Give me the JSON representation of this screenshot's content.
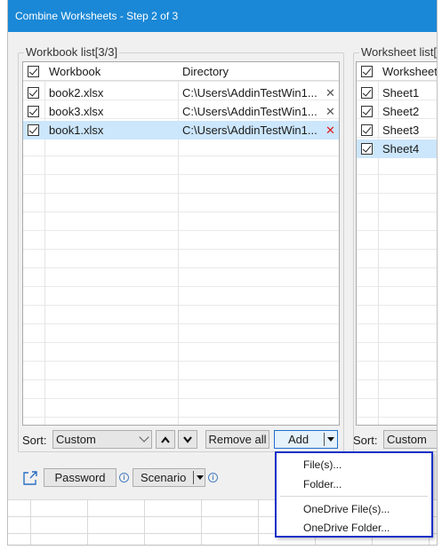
{
  "window": {
    "title": "Combine Worksheets - Step 2 of 3"
  },
  "workbook_panel": {
    "title": "Workbook list[3/3]",
    "columns": [
      "Workbook",
      "Directory"
    ],
    "rows": [
      {
        "name": "book2.xlsx",
        "directory": "C:\\Users\\AddinTestWin1...",
        "checked": true,
        "selected": false
      },
      {
        "name": "book3.xlsx",
        "directory": "C:\\Users\\AddinTestWin1...",
        "checked": true,
        "selected": false
      },
      {
        "name": "book1.xlsx",
        "directory": "C:\\Users\\AddinTestWin1...",
        "checked": true,
        "selected": true
      }
    ],
    "sort_label": "Sort:",
    "sort_value": "Custom",
    "remove_all_label": "Remove all",
    "add_label": "Add"
  },
  "worksheet_panel": {
    "title": "Worksheet list[4",
    "column": "Worksheet",
    "rows": [
      {
        "name": "Sheet1",
        "checked": true,
        "selected": false
      },
      {
        "name": "Sheet2",
        "checked": true,
        "selected": false
      },
      {
        "name": "Sheet3",
        "checked": true,
        "selected": false
      },
      {
        "name": "Sheet4",
        "checked": true,
        "selected": true
      }
    ],
    "sort_label": "Sort:",
    "sort_value": "Custom"
  },
  "footer": {
    "password_label": "Password",
    "scenario_label": "Scenario"
  },
  "add_menu": {
    "items": [
      "File(s)...",
      "Folder...",
      "OneDrive File(s)...",
      "OneDrive Folder..."
    ]
  },
  "colors": {
    "title_bar": "#1a88d6",
    "selection": "#cce6fb",
    "menu_border": "#1530c8",
    "delete_red": "#e01818"
  },
  "icons": [
    "checkbox-icon",
    "delete-icon",
    "up-arrow-icon",
    "down-arrow-icon",
    "dropdown-arrow-icon",
    "share-icon",
    "info-icon"
  ]
}
